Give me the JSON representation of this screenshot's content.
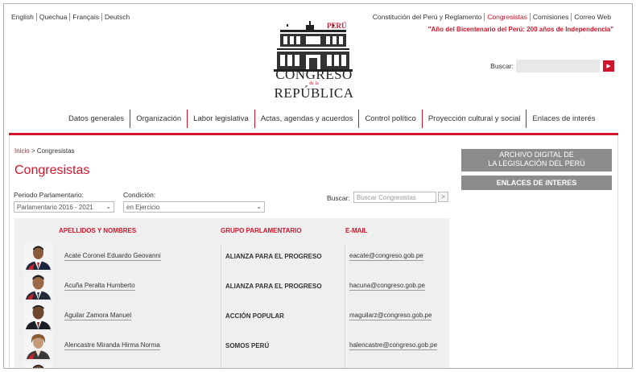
{
  "languages": [
    "English",
    "Quechua",
    "Français",
    "Deutsch"
  ],
  "top_links": [
    {
      "label": "Constitución del Perú y Reglamento",
      "active": false
    },
    {
      "label": "Congresistas",
      "active": true
    },
    {
      "label": "Comisiones",
      "active": false
    },
    {
      "label": "Correo Web",
      "active": false
    }
  ],
  "bicentenario": "\"Año del Bicentenario del Perú: 200 años de Independencia\"",
  "logo": {
    "country": "PERÚ",
    "line1": "CONGRESO",
    "line2": "de la",
    "line3": "REPÚBLICA"
  },
  "header_search": {
    "label": "Buscar:",
    "placeholder": "",
    "button_icon": "play-arrow-icon"
  },
  "main_nav": [
    "Datos generales",
    "Organización",
    "Labor legislativa",
    "Actas, agendas y acuerdos",
    "Control político",
    "Proyección cultural y social",
    "Enlaces de interés"
  ],
  "breadcrumb": {
    "home": "Inicio",
    "separator": ">",
    "current": "Congresistas"
  },
  "page_title": "Congresistas",
  "filters": {
    "period_label": "Periodo Parlamentario:",
    "period_value": "Parlamentario 2016 - 2021",
    "condition_label": "Condición:",
    "condition_value": "en Ejercicio",
    "search_label": "Buscar:",
    "search_placeholder": "Buscar Congresistas",
    "search_button": ">"
  },
  "table": {
    "headers": [
      "APELLIDOS Y NOMBRES",
      "GRUPO PARLAMENTARIO",
      "E-MAIL"
    ],
    "rows": [
      {
        "name": "Acate Coronel Eduardo Geovanni",
        "group": "ALIANZA PARA EL PROGRESO",
        "email": "eacate@congreso.gob.pe"
      },
      {
        "name": "Acuña Peralta Humberto",
        "group": "ALIANZA PARA EL PROGRESO",
        "email": "hacuna@congreso.gob.pe"
      },
      {
        "name": "Aguilar Zamora Manuel",
        "group": "ACCIÓN POPULAR",
        "email": "maguilarz@congreso.gob.pe"
      },
      {
        "name": "Alencastre Miranda Hirma Norma",
        "group": "SOMOS PERÚ",
        "email": "halencastre@congreso.gob.pe"
      },
      {
        "name": "",
        "group": "",
        "email": ""
      }
    ]
  },
  "sidebar": {
    "archive_line1": "ARCHIVO DIGITAL DE",
    "archive_line2": "LA LEGISLACIÓN DEL PERÚ",
    "links": "ENLACES DE INTERES"
  },
  "colors": {
    "accent": "#d0152b",
    "sidebar": "#8c8c8c",
    "table_bg": "#efefef"
  }
}
